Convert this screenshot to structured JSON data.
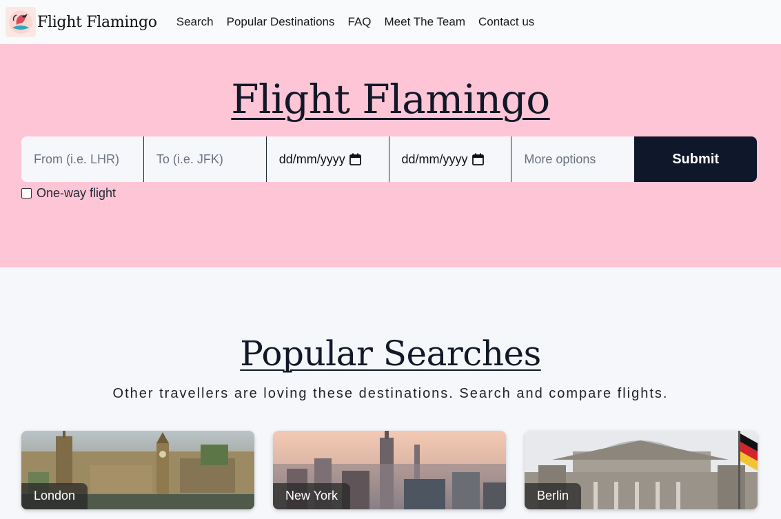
{
  "nav": {
    "brand": "Flight Flamingo",
    "links": [
      "Search",
      "Popular Destinations",
      "FAQ",
      "Meet The Team",
      "Contact us"
    ]
  },
  "hero": {
    "title": "Flight Flamingo",
    "from_placeholder": "From (i.e. LHR)",
    "to_placeholder": "To (i.e. JFK)",
    "depart_date": "dd/mm/yyyy",
    "return_date": "dd/mm/yyyy",
    "more_options_placeholder": "More options",
    "submit_label": "Submit",
    "oneway_label": "One-way flight",
    "oneway_checked": false
  },
  "popular": {
    "title": "Popular Searches",
    "subtitle": "Other travellers are loving these destinations. Search and compare flights.",
    "cards": [
      {
        "label": "London"
      },
      {
        "label": "New York"
      },
      {
        "label": "Berlin"
      }
    ]
  },
  "colors": {
    "hero_bg": "#fec5d6",
    "submit_bg": "#0f172a",
    "page_bg": "#f6f7fb"
  }
}
